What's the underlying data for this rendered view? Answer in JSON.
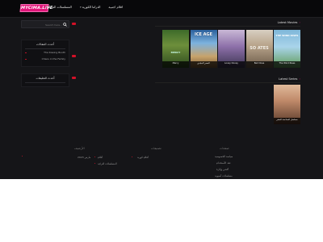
{
  "header": {
    "logo_text": "MYCIMA.LIVE",
    "nav": [
      {
        "label": "افلام اجنبية",
        "caret": false
      },
      {
        "label": "الدراما الكورية",
        "caret": true
      },
      {
        "label": "المسلسلات التركية",
        "caret": true
      }
    ]
  },
  "sidebar": {
    "search_placeholder": "Search here...",
    "recent_posts": {
      "title": "أحدث المقالات",
      "items": [
        "The Kissing Booth",
        "Chaos in the Family"
      ]
    },
    "recent_comments": {
      "title": "أحدث التعليقات"
    }
  },
  "main": {
    "latest_movies": {
      "title": "Latest Movies",
      "posters": [
        {
          "caption": "The Wind Rises",
          "art_text": "THE WIND RISES"
        },
        {
          "caption": "Bad Ones",
          "art_text": "SO ATES"
        },
        {
          "caption": "Lovey Dovey",
          "art_text": ""
        },
        {
          "caption": "العصر الجليدي",
          "art_text": "ICE AGE"
        },
        {
          "caption": "Mercy",
          "art_text": "MERCY"
        }
      ]
    },
    "latest_series": {
      "title": "Latest Series",
      "posters": [
        {
          "caption": "مسلسل السادسة العشر",
          "art_text": ""
        }
      ]
    }
  },
  "footer": {
    "col1": {
      "title": "صفحات",
      "links": [
        "سياسة الخصوصية",
        "عقد الأستخدام"
      ]
    },
    "col2": {
      "title": "تصنيفات",
      "links": [
        "أفلام كورية",
        "أفلام",
        "المسلسلات التركية"
      ]
    },
    "col3": {
      "title": "الأرشيف",
      "links": [
        "مارس 2023"
      ]
    },
    "col4": {
      "title": "",
      "links": [
        "أكشن وإثارة",
        "مسلسلات آسيوية",
        "افلام أجنبية",
        "كوميدية"
      ]
    }
  },
  "colors": {
    "accent": "#e2167b",
    "marker": "#d31027",
    "page_bg": "#151518"
  }
}
